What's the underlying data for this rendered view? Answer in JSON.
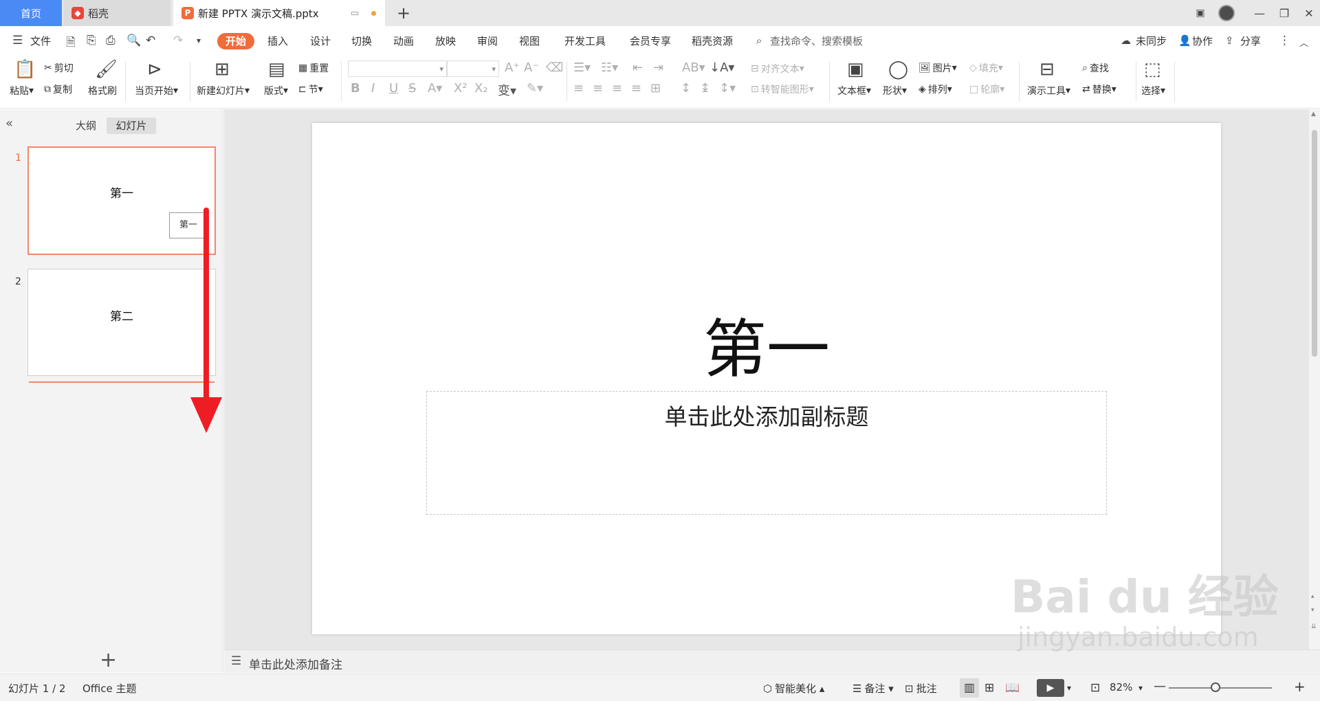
{
  "titlebar": {
    "home_tab": "首页",
    "daoke_tab": "稻壳",
    "doc_tab": "新建 PPTX 演示文稿.pptx",
    "add_tab": "+",
    "colors": {
      "home_bg": "#4a8af4",
      "wps_red": "#e8453c",
      "ppt_orange": "#f26b3c"
    }
  },
  "menubar": {
    "file": "文件",
    "items": [
      {
        "label": "开始"
      },
      {
        "label": "插入"
      },
      {
        "label": "设计"
      },
      {
        "label": "切换"
      },
      {
        "label": "动画"
      },
      {
        "label": "放映"
      },
      {
        "label": "审阅"
      },
      {
        "label": "视图"
      },
      {
        "label": "开发工具"
      },
      {
        "label": "会员专享"
      },
      {
        "label": "稻壳资源"
      }
    ],
    "search": "查找命令、搜索模板",
    "sync": "未同步",
    "collab": "协作",
    "share": "分享"
  },
  "ribbon": {
    "paste": "粘贴",
    "cut": "剪切",
    "copy": "复制",
    "format_painter": "格式刷",
    "from_current": "当页开始",
    "new_slide": "新建幻灯片",
    "layout": "版式",
    "reset": "重置",
    "section": "节",
    "align_text": "对齐文本",
    "smart_art": "转智能图形",
    "textbox": "文本框",
    "shape": "形状",
    "picture": "图片",
    "arrange": "排列",
    "fill": "填充",
    "outline": "轮廓",
    "present_tools": "演示工具",
    "find": "查找",
    "replace": "替换",
    "select": "选择"
  },
  "leftpanel": {
    "outline_tab": "大纲",
    "slides_tab": "幻灯片",
    "slides": [
      {
        "num": "1",
        "title": "第一",
        "subtitle_preview": "第一"
      },
      {
        "num": "2",
        "title": "第二"
      }
    ],
    "add": "+"
  },
  "slide": {
    "title": "第一",
    "subtitle": "单击此处添加副标题"
  },
  "notes": {
    "placeholder": "单击此处添加备注"
  },
  "statusbar": {
    "slide_count": "幻灯片 1 / 2",
    "theme": "Office 主题",
    "beautify": "智能美化",
    "notes": "备注",
    "comments": "批注",
    "zoom": "82%"
  },
  "watermark": {
    "logo": "Bai du 经验",
    "url": "jingyan.baidu.com"
  }
}
